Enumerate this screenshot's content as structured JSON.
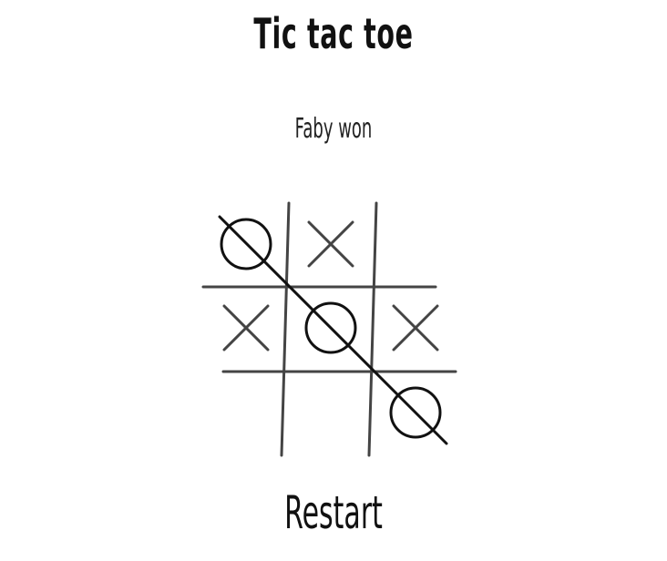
{
  "title": "Tic tac toe",
  "status": "Faby won",
  "restart_label": "Restart",
  "board": [
    "O",
    "X",
    "",
    "X",
    "O",
    "X",
    "",
    "",
    "O"
  ],
  "winning_line": "diagonal-top-left-to-bottom-right",
  "colors": {
    "grid": "#444444",
    "x_mark": "#444444",
    "o_mark": "#111111",
    "win_line": "#111111"
  }
}
